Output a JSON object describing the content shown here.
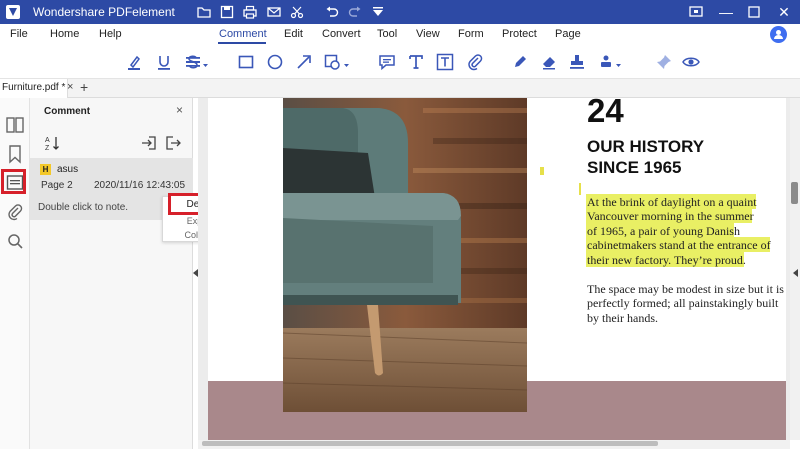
{
  "app": {
    "title": "Wondershare PDFelement",
    "colors": {
      "title_bar": "#2d4aa5",
      "accent": "#2d4aa5",
      "highlight": "#e9ef64",
      "callout": "#d6202a"
    }
  },
  "titlebar": {
    "quick_icons": [
      "folder-icon",
      "save-icon",
      "print-icon",
      "mail-icon",
      "cut-icon",
      "undo-icon",
      "redo-icon",
      "dropdown-icon"
    ],
    "window_icons": [
      "feedback-icon",
      "minimize-icon",
      "maximize-icon",
      "close-icon"
    ]
  },
  "menu": {
    "items": [
      "File",
      "Home",
      "Help",
      "Comment",
      "Edit",
      "Convert",
      "Tool",
      "View",
      "Form",
      "Protect",
      "Page"
    ],
    "active": "Comment"
  },
  "toolbar": {
    "icons": [
      "highlight-icon",
      "underline-icon",
      "strikethrough-icon",
      "line-style-icon",
      "rectangle-icon",
      "ellipse-icon",
      "arrow-icon",
      "shape-menu-icon",
      "note-icon",
      "textbox-icon",
      "text-field-icon",
      "attachment-icon",
      "pencil-icon",
      "eraser-icon",
      "stamp-icon",
      "signature-icon",
      "pin-icon",
      "eye-icon"
    ]
  },
  "tabs": {
    "document": "Furniture.pdf *",
    "close": "×",
    "add": "+"
  },
  "rail": {
    "icons": [
      "thumbnails-icon",
      "bookmark-icon",
      "comment-icon",
      "attachment-icon",
      "search-icon"
    ]
  },
  "panel": {
    "title": "Comment",
    "close": "×",
    "comment": {
      "badge": "H",
      "author": "asus",
      "page": "Page 2",
      "date": "2020/11/16 12:43:05",
      "note": "Double click to note."
    }
  },
  "context_menu": {
    "items": [
      "Delete",
      "Expand All",
      "Collapse All"
    ]
  },
  "document": {
    "number": "24",
    "heading_line1": "OUR HISTORY",
    "heading_line2": "SINCE 1965",
    "highlighted_lines": [
      "At the brink of daylight on a quaint",
      "Vancouver morning in the summer",
      "of 1965, a pair of young Danish",
      "cabinetmakers stand at the entrance of",
      "their new factory. They’re proud."
    ],
    "paragraph_lines": [
      "The space may be modest in size but it is",
      "perfectly formed; all painstakingly built",
      "by their hands."
    ]
  }
}
